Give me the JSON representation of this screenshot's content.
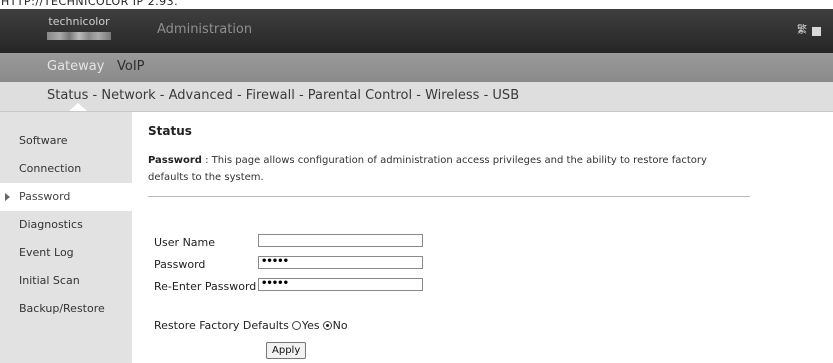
{
  "url_strip": "HTTP://TECHNICOLOR IP 2.93.",
  "header": {
    "logo_text": "technicolor",
    "title": "Administration"
  },
  "top_nav": {
    "items": [
      "Gateway",
      "VoIP"
    ]
  },
  "sub_nav": {
    "items": [
      "Status - ",
      "Network - ",
      "Advanced - ",
      "Firewall - ",
      "Parental Control - ",
      "Wireless - ",
      "USB"
    ]
  },
  "sidebar": {
    "items": [
      "Software",
      "Connection",
      "Password",
      "Diagnostics",
      "Event Log",
      "Initial Scan",
      "Backup/Restore"
    ]
  },
  "main": {
    "title": "Status",
    "desc_label": "Password",
    "desc_text": "  :  This page allows configuration of administration access privileges and the ability to restore factory defaults to the system.",
    "form": {
      "username_label": "User Name",
      "username_value": "",
      "password_label": "Password",
      "password_value": "•••••",
      "reenter_label": "Re-Enter Password",
      "reenter_value": "•••••",
      "restore_label": "Restore Factory Defaults",
      "yes_label": "Yes",
      "no_label": "No",
      "restore_selected": "No",
      "apply_label": "Apply"
    }
  }
}
